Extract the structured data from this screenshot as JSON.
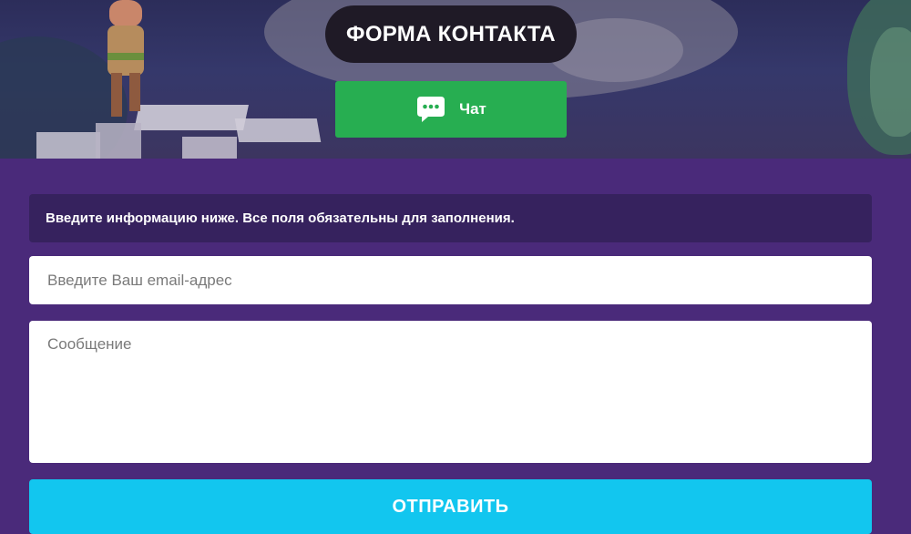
{
  "header": {
    "title": "ФОРМА КОНТАКТА",
    "chat_button": {
      "label": "Чат",
      "icon": "chat-bubble-icon",
      "color": "#27ae51"
    }
  },
  "form": {
    "notice": "Введите информацию ниже. Все поля обязательны для заполнения.",
    "email": {
      "value": "",
      "placeholder": "Введите Ваш email-адрес"
    },
    "message": {
      "value": "",
      "placeholder": "Сообщение"
    },
    "submit_label": "ОТПРАВИТЬ"
  },
  "colors": {
    "background": "#4a2a7a",
    "notice_bg": "#36225e",
    "submit": "#12c6ef",
    "title_pill": "#1f1a26"
  }
}
